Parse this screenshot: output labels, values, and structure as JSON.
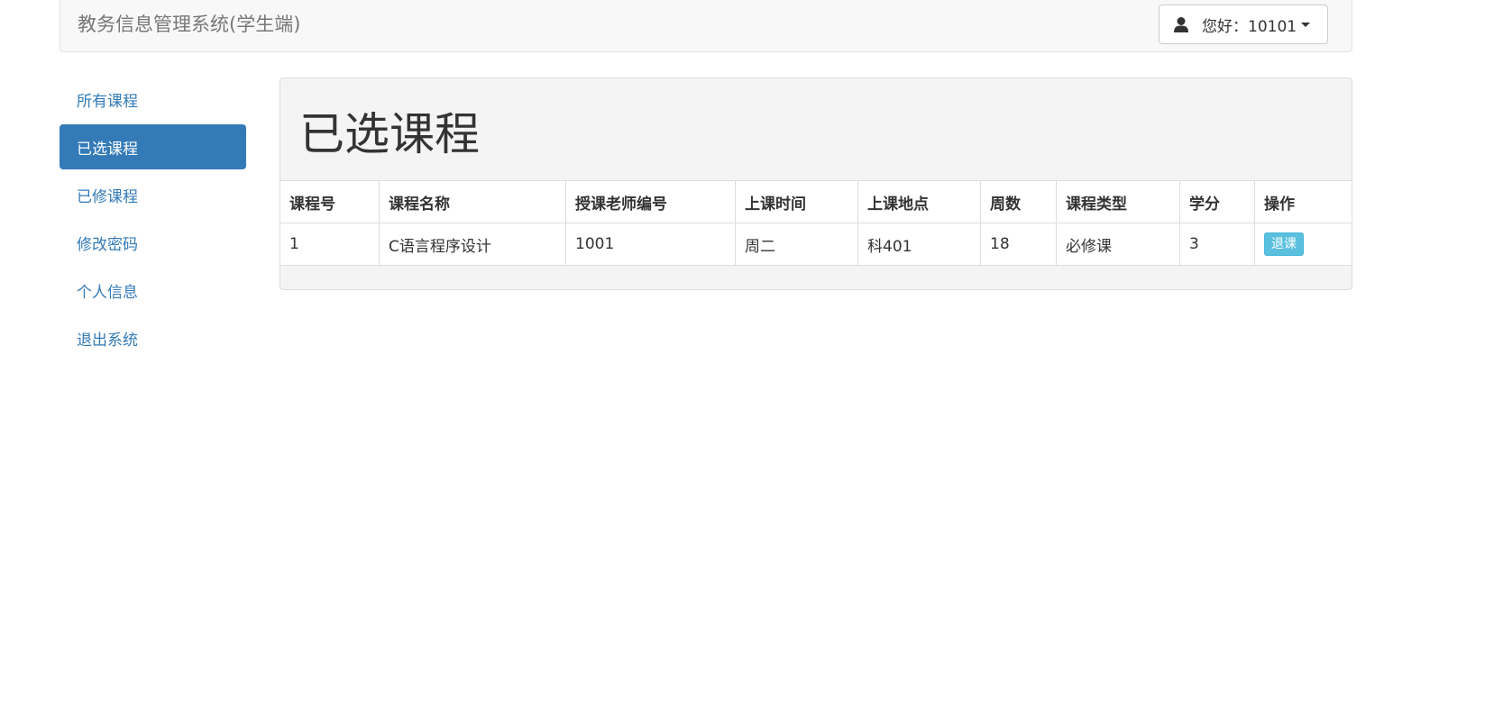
{
  "header": {
    "brand": "教务信息管理系统(学生端)",
    "user_label": "您好：10101",
    "user_icon": "user-icon",
    "dropdown_icon": "caret-down-icon"
  },
  "sidebar": {
    "items": [
      {
        "label": "所有课程",
        "active": false
      },
      {
        "label": "已选课程",
        "active": true
      },
      {
        "label": "已修课程",
        "active": false
      },
      {
        "label": "修改密码",
        "active": false
      },
      {
        "label": "个人信息",
        "active": false
      },
      {
        "label": "退出系统",
        "active": false
      }
    ]
  },
  "main": {
    "title": "已选课程",
    "table": {
      "headers": [
        "课程号",
        "课程名称",
        "授课老师编号",
        "上课时间",
        "上课地点",
        "周数",
        "课程类型",
        "学分",
        "操作"
      ],
      "rows": [
        {
          "cells": [
            "1",
            "C语言程序设计",
            "1001",
            "周二",
            "科401",
            "18",
            "必修课",
            "3"
          ],
          "action_label": "退课"
        }
      ]
    }
  },
  "colors": {
    "primary": "#337ab7",
    "info": "#5bc0de",
    "panel_bg": "#f4f4f4",
    "navbar_bg": "#f8f8f8"
  }
}
